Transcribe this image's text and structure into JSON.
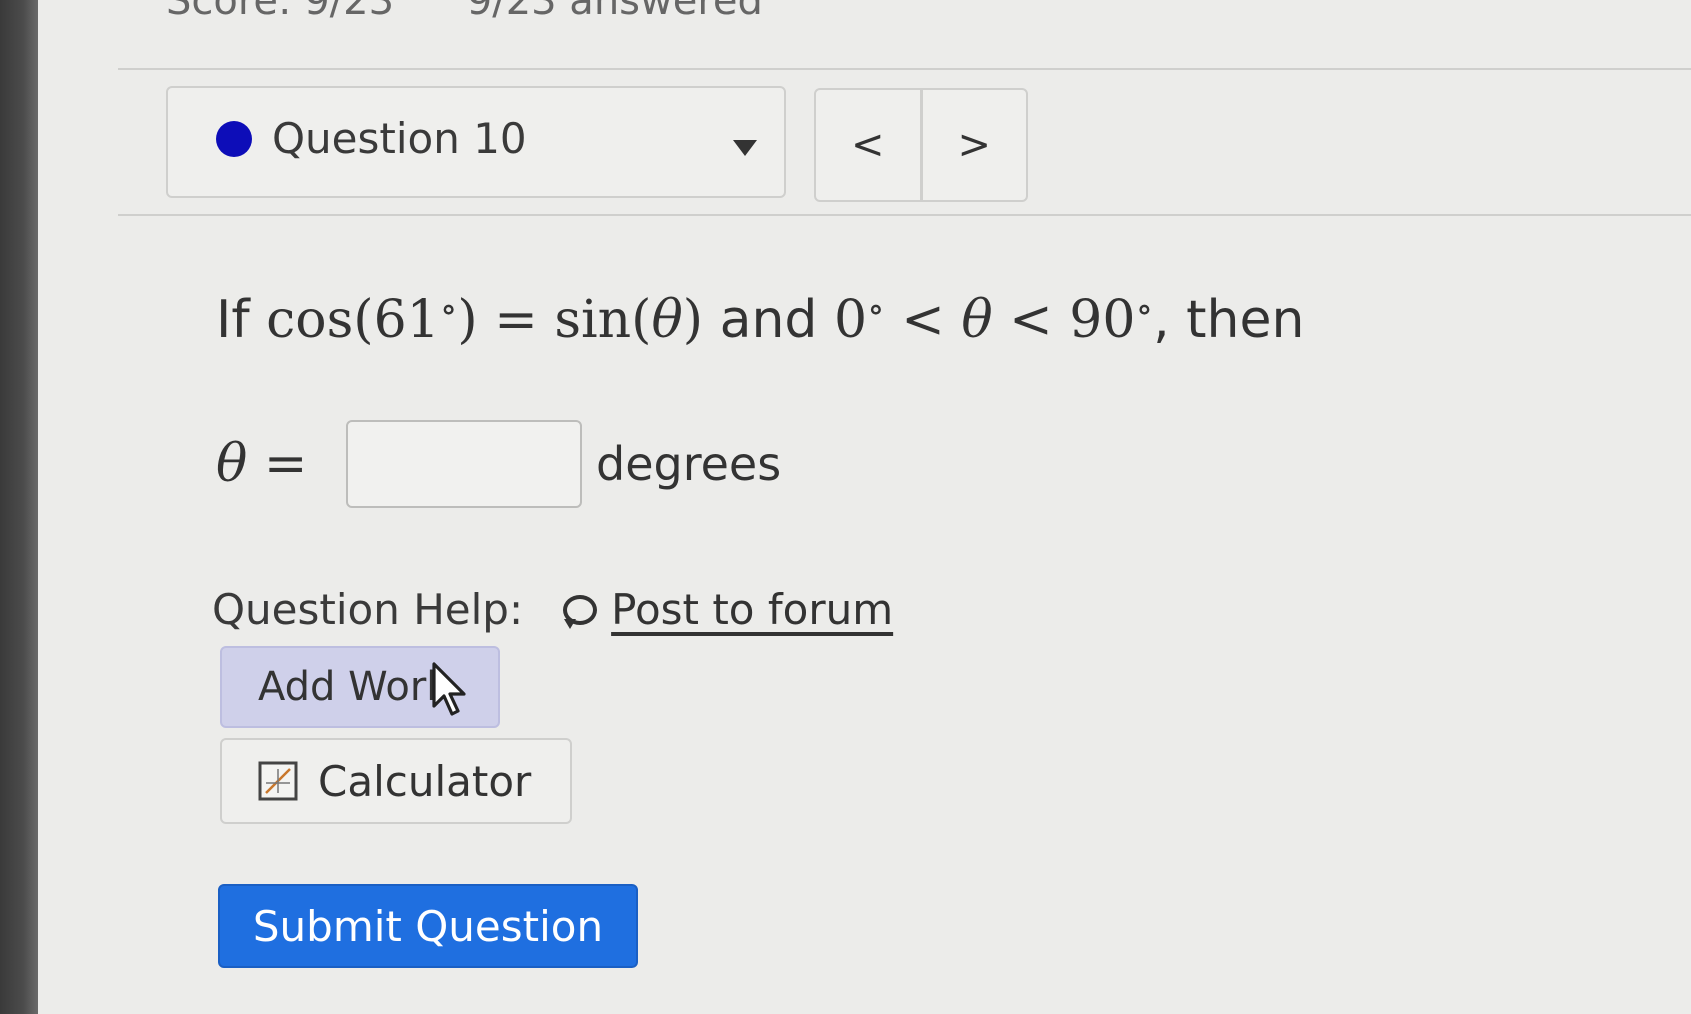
{
  "header": {
    "score_text": "Score: 9/23",
    "answered_text": "9/23 answered"
  },
  "question_selector": {
    "label": "Question 10",
    "status_color": "#0d0db8"
  },
  "nav": {
    "prev_label": "<",
    "next_label": ">"
  },
  "question": {
    "prefix": "If ",
    "cos_expr": "cos(61",
    "degree_mark": "∘",
    "close_paren": ")",
    "eq": " = ",
    "sin_expr": "sin(",
    "theta": "θ",
    "sin_close": ")",
    "and_text": " and ",
    "zero": "0",
    "lt": " < ",
    "ninety": "90",
    "then_text": ", then"
  },
  "answer": {
    "label_theta": "θ",
    "label_eq": " =",
    "value": "",
    "unit": "degrees"
  },
  "help": {
    "label": "Question Help:",
    "forum_link": "Post to forum",
    "add_work_label": "Add Work",
    "calculator_label": "Calculator"
  },
  "actions": {
    "submit_label": "Submit Question",
    "submit_color": "#1f6fe0"
  }
}
